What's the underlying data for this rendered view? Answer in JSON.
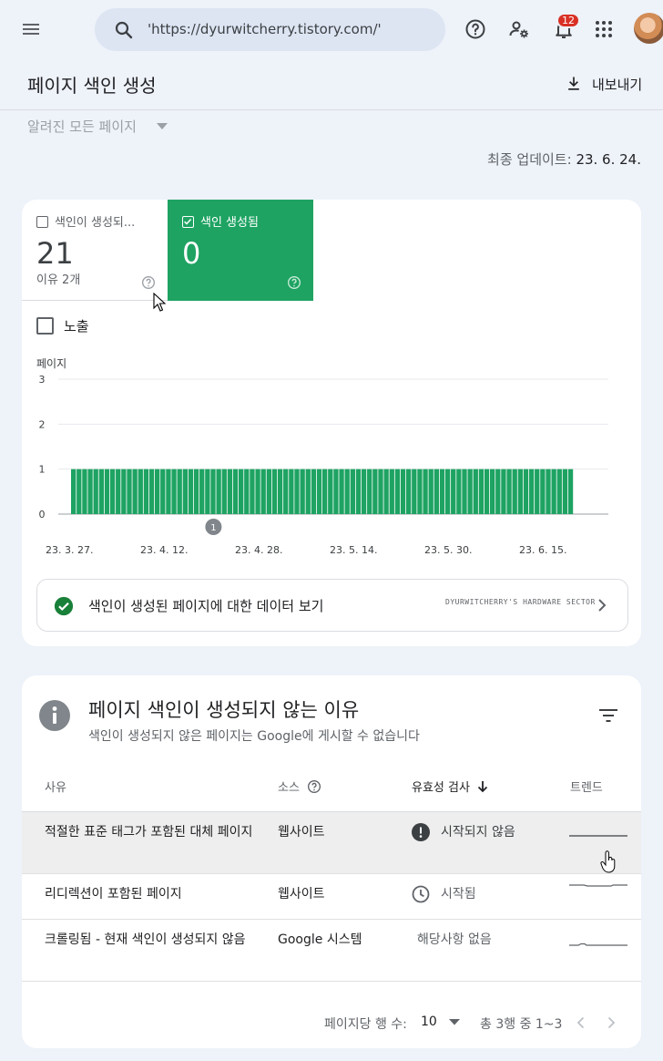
{
  "search": {
    "value": "'https://dyurwitcherry.tistory.com/'"
  },
  "notifications": {
    "count": "12"
  },
  "header": {
    "title": "페이지 색인 생성",
    "export_label": "내보내기"
  },
  "filter": {
    "selected": "알려진 모든 페이지"
  },
  "last_update": {
    "label": "최종 업데이트:",
    "value": "23. 6. 24."
  },
  "tiles": {
    "not_indexed": {
      "label": "색인이 생성되...",
      "count": "21",
      "sub": "이유 2개",
      "checked": false
    },
    "indexed": {
      "label": "색인 생성됨",
      "count": "0",
      "checked": true
    }
  },
  "impressions": {
    "label": "노출",
    "checked": false
  },
  "chart_data": {
    "type": "bar",
    "ylabel": "페이지",
    "ylim": [
      0,
      3
    ],
    "yticks": [
      "3",
      "2",
      "1",
      "0"
    ],
    "xticks": [
      "23. 3. 27.",
      "23. 4. 12.",
      "23. 4. 28.",
      "23. 5. 14.",
      "23. 5. 30.",
      "23. 6. 15."
    ],
    "color": "#1ea362",
    "bar_count": 90,
    "bar_value": 1,
    "annotation": "1",
    "annotation_day": 25
  },
  "data_link": {
    "label": "색인이 생성된 페이지에 대한 데이터 보기",
    "watermark": "DYURWITCHERRY'S HARDWARE SECTOR"
  },
  "reasons": {
    "title": "페이지 색인이 생성되지 않는 이유",
    "subtitle": "색인이 생성되지 않은 페이지는 Google에 게시할 수 없습니다",
    "columns": {
      "reason": "사유",
      "source": "소스",
      "validation": "유효성 검사",
      "trend": "트렌드"
    },
    "rows": [
      {
        "reason": "적절한 표준 태그가 포함된 대체 페이지",
        "source": "웹사이트",
        "validation": "시작되지 않음",
        "status_icon": "error-icon"
      },
      {
        "reason": "리디렉션이 포함된 페이지",
        "source": "웹사이트",
        "validation": "시작됨",
        "status_icon": "clock-icon"
      },
      {
        "reason": "크롤링됨 - 현재 색인이 생성되지 않음",
        "source": "Google 시스템",
        "validation": "해당사항 없음",
        "status_icon": "none"
      }
    ],
    "pager": {
      "rows_label": "페이지당 행 수:",
      "rows_value": "10",
      "range": "총 3행 중 1~3"
    }
  }
}
